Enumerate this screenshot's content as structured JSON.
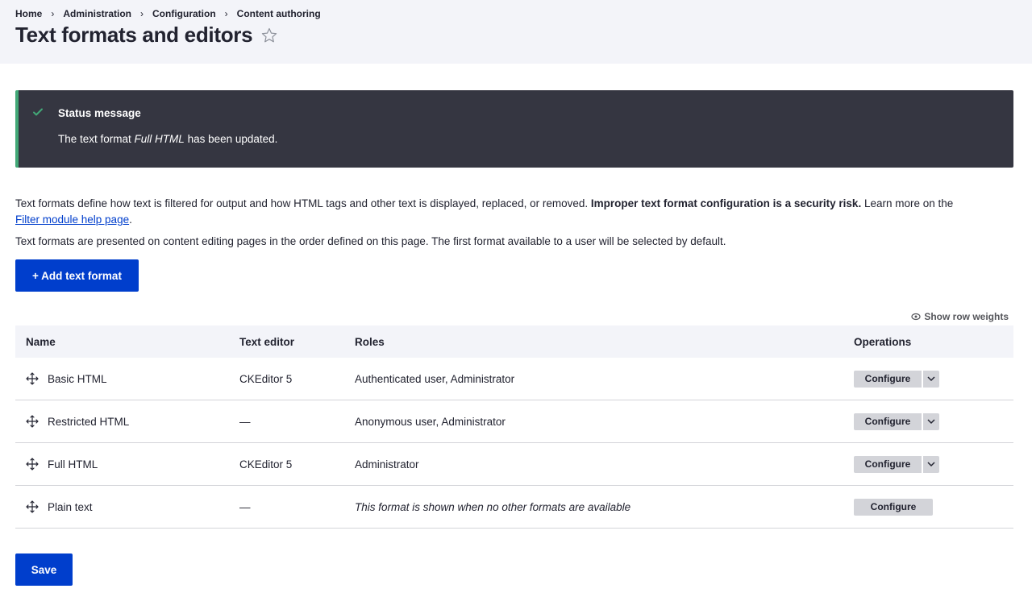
{
  "breadcrumb": [
    "Home",
    "Administration",
    "Configuration",
    "Content authoring"
  ],
  "page": {
    "title": "Text formats and editors"
  },
  "status": {
    "title": "Status message",
    "text_before": "The text format ",
    "text_em": "Full HTML",
    "text_after": " has been updated."
  },
  "description": {
    "p1_text": "Text formats define how text is filtered for output and how HTML tags and other text is displayed, replaced, or removed. ",
    "p1_strong": "Improper text format configuration is a security risk.",
    "p1_after": " Learn more on the ",
    "p1_link": "Filter module help page",
    "p1_end": ".",
    "p2": "Text formats are presented on content editing pages in the order defined on this page. The first format available to a user will be selected by default."
  },
  "actions": {
    "add_label": "+ Add text format",
    "save_label": "Save",
    "row_weights_label": "Show row weights"
  },
  "table": {
    "headers": {
      "name": "Name",
      "editor": "Text editor",
      "roles": "Roles",
      "operations": "Operations"
    },
    "rows": [
      {
        "name": "Basic HTML",
        "editor": "CKEditor 5",
        "roles": "Authenticated user, Administrator",
        "operation": "Configure"
      },
      {
        "name": "Restricted HTML",
        "editor": "—",
        "roles": "Anonymous user, Administrator",
        "operation": "Configure"
      },
      {
        "name": "Full HTML",
        "editor": "CKEditor 5",
        "roles": "Administrator",
        "operation": "Configure"
      },
      {
        "name": "Plain text",
        "editor": "—",
        "roles": "This format is shown when no other formats are available",
        "operation": "Configure"
      }
    ]
  },
  "colors": {
    "primary": "#003ecc",
    "status_bg": "#353641",
    "status_accent": "#42a877",
    "header_bg": "#f3f4f9"
  }
}
